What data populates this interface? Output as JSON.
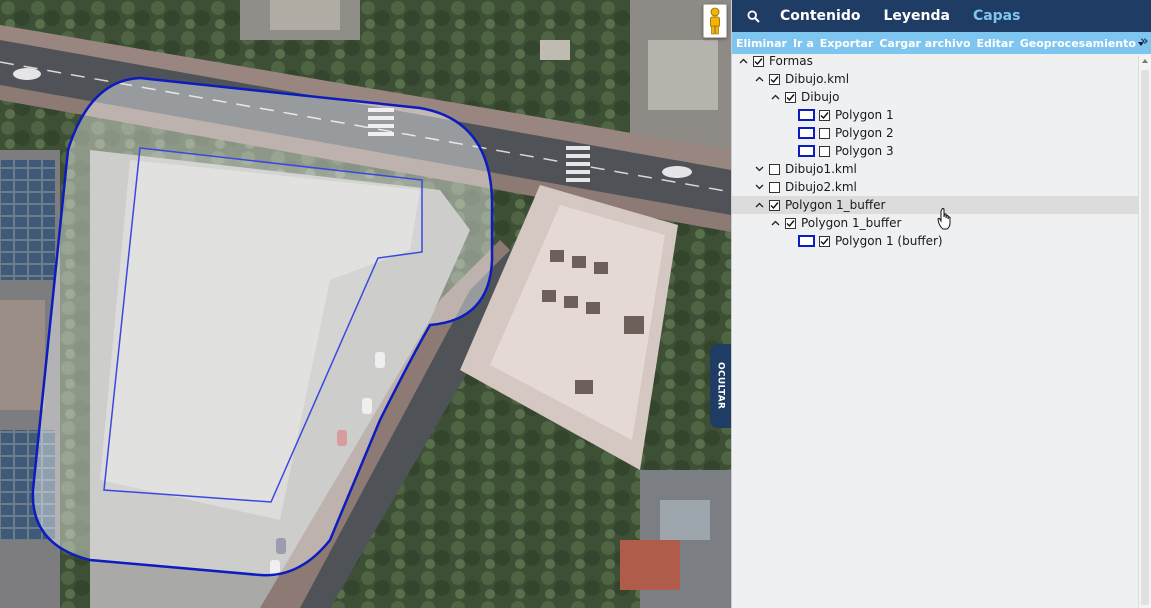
{
  "panel": {
    "tabs": [
      {
        "label": "Contenido",
        "active": false
      },
      {
        "label": "Leyenda",
        "active": false
      },
      {
        "label": "Capas",
        "active": true
      }
    ],
    "toolbar": [
      "Eliminar",
      "Ir a",
      "Exportar",
      "Cargar archivo",
      "Editar",
      "Geoprocesamiento"
    ],
    "expand_label": "»"
  },
  "map": {
    "hide_button_label": "OCULTAR",
    "icons": [
      "pegman-icon"
    ]
  },
  "tree": [
    {
      "label": "Formas",
      "indent": 0,
      "expanded": true,
      "checked": true
    },
    {
      "label": "Dibujo.kml",
      "indent": 1,
      "expanded": true,
      "checked": true
    },
    {
      "label": "Dibujo",
      "indent": 2,
      "expanded": true,
      "checked": true
    },
    {
      "label": "Polygon 1",
      "indent": 3,
      "leaf": true,
      "checked": true
    },
    {
      "label": "Polygon 2",
      "indent": 3,
      "leaf": true,
      "checked": false
    },
    {
      "label": "Polygon 3",
      "indent": 3,
      "leaf": true,
      "checked": false
    },
    {
      "label": "Dibujo1.kml",
      "indent": 1,
      "expanded": false,
      "checked": false
    },
    {
      "label": "Dibujo2.kml",
      "indent": 1,
      "expanded": false,
      "checked": false
    },
    {
      "label": "Polygon 1_buffer",
      "indent": 1,
      "expanded": true,
      "checked": true,
      "highlight": true
    },
    {
      "label": "Polygon 1_buffer",
      "indent": 2,
      "expanded": true,
      "checked": true
    },
    {
      "label": "Polygon 1 (buffer)",
      "indent": 3,
      "leaf": true,
      "checked": true
    }
  ],
  "colors": {
    "header": "#1f3c64",
    "toolbar": "#7ec6f0",
    "active_tab": "#7ec6f0",
    "polygon_stroke": "#0c1cbf"
  }
}
